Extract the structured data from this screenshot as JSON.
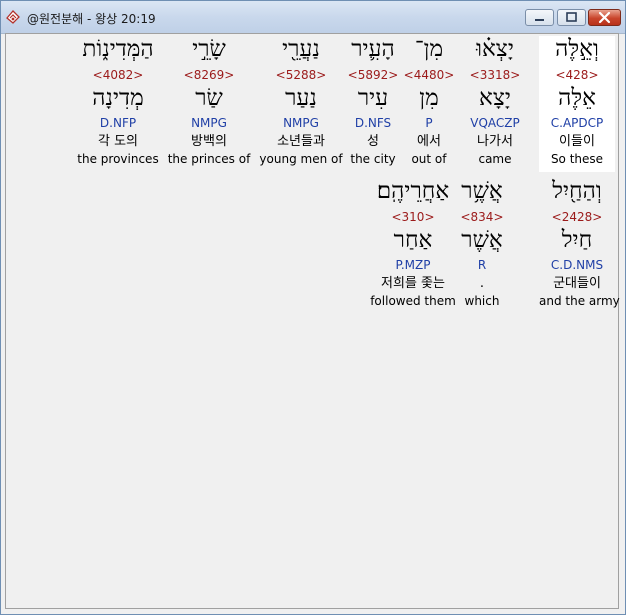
{
  "window": {
    "title": "@원전분해 - 왕상 20:19"
  },
  "rows": [
    [
      {
        "heb": "וְאֵ֣לֶּה",
        "strong": "<428>",
        "lemma": "אֵלֶּה",
        "morph": "C.APDCP",
        "kor": "이들이",
        "eng": "So these",
        "selected": true
      },
      {
        "heb": "יָצְא֗וּ",
        "strong": "<3318>",
        "lemma": "יָצָא",
        "morph": "VQACZP",
        "kor": "나가서",
        "eng": "came"
      },
      {
        "heb": "מִן־",
        "strong": "<4480>",
        "lemma": "מִן",
        "morph": "P",
        "kor": "에서",
        "eng": "out of"
      },
      {
        "heb": "הָעִ֛יר",
        "strong": "<5892>",
        "lemma": "עִיר",
        "morph": "D.NFS",
        "kor": "성",
        "eng": "the city"
      },
      {
        "heb": "נַעֲרֵ֖י",
        "strong": "<5288>",
        "lemma": "נַעַר",
        "morph": "NMPG",
        "kor": "소년들과",
        "eng": "young men of"
      },
      {
        "heb": "שָׂרֵ֣י",
        "strong": "<8269>",
        "lemma": "שַׂר",
        "morph": "NMPG",
        "kor": "방백의",
        "eng": "the princes of"
      },
      {
        "heb": "הַמְּדִינ֑וֹת",
        "strong": "<4082>",
        "lemma": "מְדִינָה",
        "morph": "D.NFP",
        "kor": "각 도의",
        "eng": "the provinces"
      }
    ],
    [
      {
        "heb": "וְהַחַ֖יִל",
        "strong": "<2428>",
        "lemma": "חַיִל",
        "morph": "C.D.NMS",
        "kor": "군대들이",
        "eng": "and the army"
      },
      {
        "heb": "אֲשֶׁ֥ר",
        "strong": "<834>",
        "lemma": "אֲשֶׁר",
        "morph": "R",
        "kor": ".",
        "eng": "which"
      },
      {
        "heb": "אַחֲרֵיהֶֽם׃",
        "strong": "<310>",
        "lemma": "אַחַר",
        "morph": "P.MZP",
        "kor": "저희를 좇는",
        "eng": "followed them"
      }
    ]
  ]
}
